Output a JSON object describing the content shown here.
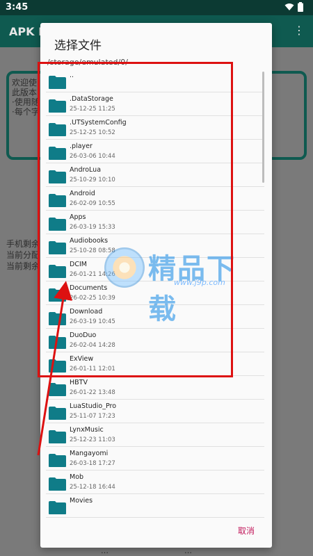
{
  "statusbar": {
    "time": "3:45"
  },
  "appbar": {
    "title": "APK E",
    "menu_icon": "⋮"
  },
  "background": {
    "texts": [
      "欢迎使",
      "此版本",
      "·使用随",
      "·每个字"
    ],
    "left_texts": [
      "手机剩余",
      "当前分配",
      "当前剩余"
    ],
    "bottom_texts": [
      "…",
      "…"
    ]
  },
  "dialog": {
    "title": "选择文件",
    "path": "/storage/emulated/0/",
    "cancel_label": "取消",
    "folders": [
      {
        "name": "..",
        "date": ""
      },
      {
        "name": ".DataStorage",
        "date": "25-12-25 11:25"
      },
      {
        "name": ".UTSystemConfig",
        "date": "25-12-25 10:52"
      },
      {
        "name": ".player",
        "date": "26-03-06 10:44"
      },
      {
        "name": "AndroLua",
        "date": "25-10-29 10:10"
      },
      {
        "name": "Android",
        "date": "26-02-09 10:55"
      },
      {
        "name": "Apps",
        "date": "26-03-19 15:33"
      },
      {
        "name": "Audiobooks",
        "date": "25-10-28 08:58"
      },
      {
        "name": "DCIM",
        "date": "26-01-21 14:26"
      },
      {
        "name": "Documents",
        "date": "26-02-25 10:39"
      },
      {
        "name": "Download",
        "date": "26-03-19 10:45"
      },
      {
        "name": "DuoDuo",
        "date": "26-02-04 14:28"
      },
      {
        "name": "ExView",
        "date": "26-01-11 12:01"
      },
      {
        "name": "HBTV",
        "date": "26-01-22 13:48"
      },
      {
        "name": "LuaStudio_Pro",
        "date": "25-11-07 17:23"
      },
      {
        "name": "LynxMusic",
        "date": "25-12-23 11:03"
      },
      {
        "name": "Mangayomi",
        "date": "26-03-18 17:27"
      },
      {
        "name": "Mob",
        "date": "25-12-18 16:44"
      },
      {
        "name": "Movies",
        "date": ""
      }
    ]
  },
  "watermark": {
    "text": "精品下载",
    "sub": "www.j9p.com"
  },
  "colors": {
    "folder": "#0f7c88",
    "accent": "#0f5a50",
    "cancel": "#c2185b",
    "annotation": "#dd1111"
  }
}
